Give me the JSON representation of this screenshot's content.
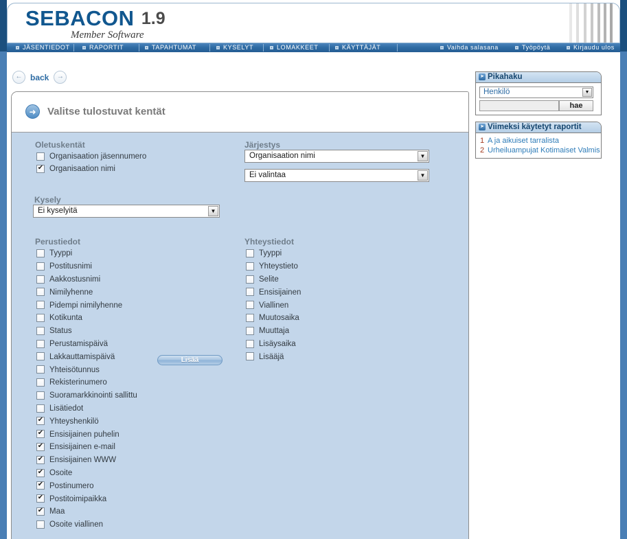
{
  "header": {
    "logo_text": "SEBACON",
    "version": "1.9",
    "tagline": "Member Software"
  },
  "navbar": {
    "left_items": [
      {
        "label": "JÄSENTIEDOT"
      },
      {
        "label": "RAPORTIT"
      },
      {
        "label": "TAPAHTUMAT"
      },
      {
        "label": "KYSELYT"
      },
      {
        "label": "LOMAKKEET"
      },
      {
        "label": "KÄYTTÄJÄT"
      }
    ],
    "right_items": [
      {
        "label": "Vaihda salasana"
      },
      {
        "label": "Työpöytä"
      },
      {
        "label": "Kirjaudu ulos"
      }
    ]
  },
  "back_row": {
    "label": "back",
    "prev_icon": "arrow-left-icon",
    "next_icon": "arrow-right-icon"
  },
  "panel": {
    "title": "Valitse tulostuvat kentät",
    "title_icon": "arrow-right-circle-icon"
  },
  "form": {
    "oletuskentat": {
      "label": "Oletuskentät",
      "items": [
        {
          "label": "Organisaation jäsennumero",
          "checked": false
        },
        {
          "label": "Organisaation nimi",
          "checked": true
        }
      ]
    },
    "jarjestys": {
      "label": "Järjestys",
      "select1_value": "Organisaation nimi",
      "select2_value": "Ei valintaa"
    },
    "kysely": {
      "label": "Kysely",
      "select_value": "Ei kyselyitä",
      "add_button": "Lisää"
    },
    "perustiedot": {
      "label": "Perustiedot",
      "items": [
        {
          "label": "Tyyppi",
          "checked": false
        },
        {
          "label": "Postitusnimi",
          "checked": false
        },
        {
          "label": "Aakkostusnimi",
          "checked": false
        },
        {
          "label": "Nimilyhenne",
          "checked": false
        },
        {
          "label": "Pidempi nimilyhenne",
          "checked": false
        },
        {
          "label": "Kotikunta",
          "checked": false
        },
        {
          "label": "Status",
          "checked": false
        },
        {
          "label": "Perustamispäivä",
          "checked": false
        },
        {
          "label": "Lakkauttamispäivä",
          "checked": false
        },
        {
          "label": "Yhteisötunnus",
          "checked": false
        },
        {
          "label": "Rekisterinumero",
          "checked": false
        },
        {
          "label": "Suoramarkkinointi sallittu",
          "checked": false
        },
        {
          "label": "Lisätiedot",
          "checked": false
        },
        {
          "label": "Yhteyshenkilö",
          "checked": true
        },
        {
          "label": "Ensisijainen puhelin",
          "checked": true
        },
        {
          "label": "Ensisijainen e-mail",
          "checked": true
        },
        {
          "label": "Ensisijainen WWW",
          "checked": true
        },
        {
          "label": "Osoite",
          "checked": true
        },
        {
          "label": "Postinumero",
          "checked": true
        },
        {
          "label": "Postitoimipaikka",
          "checked": true
        },
        {
          "label": "Maa",
          "checked": true
        },
        {
          "label": "Osoite viallinen",
          "checked": false
        }
      ]
    },
    "yhteystiedot": {
      "label": "Yhteystiedot",
      "items": [
        {
          "label": "Tyyppi",
          "checked": false
        },
        {
          "label": "Yhteystieto",
          "checked": false
        },
        {
          "label": "Selite",
          "checked": false
        },
        {
          "label": "Ensisijainen",
          "checked": false
        },
        {
          "label": "Viallinen",
          "checked": false
        },
        {
          "label": "Muutosaika",
          "checked": false
        },
        {
          "label": "Muuttaja",
          "checked": false
        },
        {
          "label": "Lisäysaika",
          "checked": false
        },
        {
          "label": "Lisääjä",
          "checked": false
        }
      ]
    }
  },
  "sidebar": {
    "pikahaku": {
      "title": "Pikahaku",
      "icon": "arrow-right-box-icon",
      "select_value": "Henkilö",
      "input_value": "",
      "input_placeholder": "",
      "search_button": "hae"
    },
    "recent_reports": {
      "title": "Viimeksi käytetyt raportit",
      "icon": "arrow-right-box-icon",
      "items": [
        {
          "num": "1",
          "label": "A ja aikuiset tarralista"
        },
        {
          "num": "2",
          "label": "Urheiluampujat Kotimaiset Valmis"
        }
      ]
    }
  },
  "colors": {
    "brand_blue": "#11578f",
    "nav_blue": "#2f6ca4",
    "panel_body": "#c3d6ea",
    "link_blue": "#2e7cb8",
    "rail_blue": "#4a7fb5"
  }
}
